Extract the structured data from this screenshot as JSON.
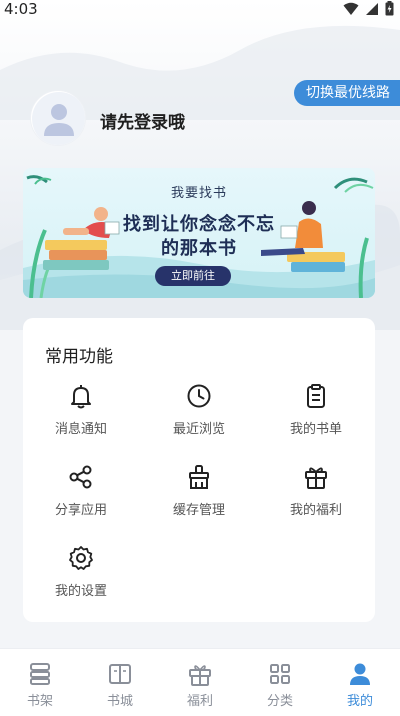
{
  "status_bar": {
    "time": "4:03"
  },
  "header": {
    "route_button": "切换最优线路",
    "login_prompt": "请先登录哦"
  },
  "banner": {
    "small_text": "我要找书",
    "line1": "找到让你念念不忘",
    "line2": "的那本书",
    "button": "立即前往"
  },
  "functions": {
    "title": "常用功能",
    "items": [
      {
        "label": "消息通知",
        "icon": "bell-icon"
      },
      {
        "label": "最近浏览",
        "icon": "clock-icon"
      },
      {
        "label": "我的书单",
        "icon": "clipboard-icon"
      },
      {
        "label": "分享应用",
        "icon": "share-icon"
      },
      {
        "label": "缓存管理",
        "icon": "broom-icon"
      },
      {
        "label": "我的福利",
        "icon": "gift-icon"
      },
      {
        "label": "我的设置",
        "icon": "gear-icon"
      }
    ]
  },
  "tabbar": {
    "items": [
      {
        "label": "书架",
        "icon": "bookshelf-icon"
      },
      {
        "label": "书城",
        "icon": "book-open-icon"
      },
      {
        "label": "福利",
        "icon": "gift-icon"
      },
      {
        "label": "分类",
        "icon": "grid-icon"
      },
      {
        "label": "我的",
        "icon": "person-icon"
      }
    ],
    "active_index": 4,
    "active_color": "#3d8cd9"
  }
}
